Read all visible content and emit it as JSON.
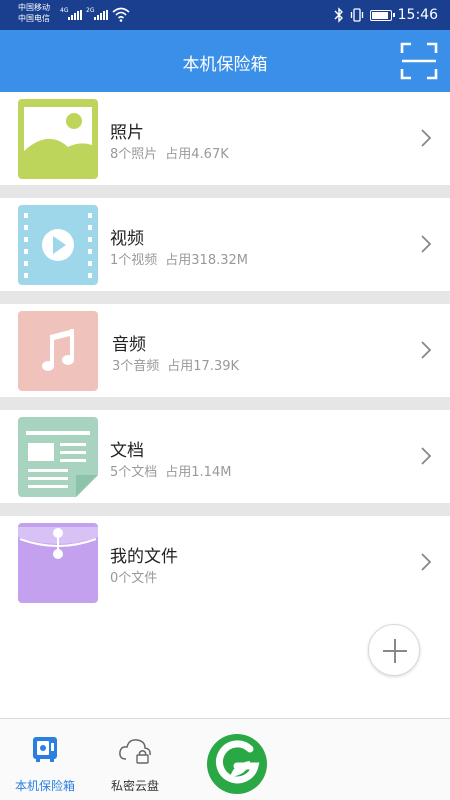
{
  "status_bar": {
    "carrier_1": "中国移动",
    "carrier_2": "中国电信",
    "network_1": "4G",
    "network_2": "2G",
    "time": "15:46"
  },
  "header": {
    "title": "本机保险箱",
    "scan_icon": "scan-icon"
  },
  "items": [
    {
      "title": "照片",
      "count": "8个照片",
      "usage": "占用4.67K",
      "icon": "photo-icon",
      "color": "#bdd55a"
    },
    {
      "title": "视频",
      "count": "1个视频",
      "usage": "占用318.32M",
      "icon": "video-icon",
      "color": "#9fd7ea"
    },
    {
      "title": "音频",
      "count": "3个音频",
      "usage": "占用17.39K",
      "icon": "music-icon",
      "color": "#efc3bb"
    },
    {
      "title": "文档",
      "count": "5个文档",
      "usage": "占用1.14M",
      "icon": "document-icon",
      "color": "#a8d4bf"
    },
    {
      "title": "我的文件",
      "count": "0个文件",
      "usage": "",
      "icon": "folder-icon",
      "color": "#c3a1ee"
    }
  ],
  "bottom_nav": {
    "local": {
      "label": "本机保险箱",
      "icon": "safe-icon"
    },
    "cloud": {
      "label": "私密云盘",
      "icon": "cloud-lock-icon"
    }
  },
  "colors": {
    "status_bar": "#1a3f8f",
    "header": "#3a8fe8",
    "accent": "#2a7fe0",
    "logo_green": "#2aa846"
  }
}
